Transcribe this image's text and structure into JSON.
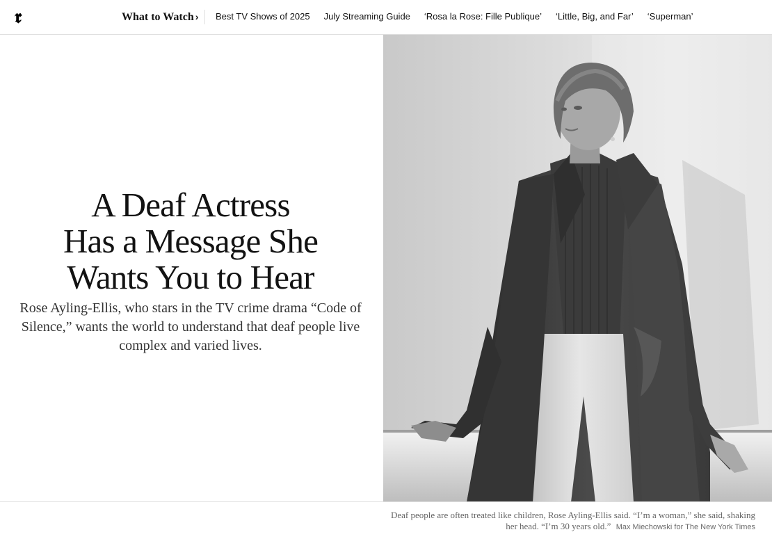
{
  "nav": {
    "logo_glyph": "𝖗",
    "section_label": "What to Watch",
    "section_chevron": "›",
    "items": [
      "Best TV Shows of 2025",
      "July Streaming Guide",
      "‘Rosa la Rose: Fille Publique’",
      "‘Little, Big, and Far’",
      "‘Superman’"
    ]
  },
  "article": {
    "headline_lines": [
      "A Deaf Actress",
      "Has a Message She",
      "Wants You to Hear"
    ],
    "summary": "Rose Ayling-Ellis, who stars in the TV crime drama “Code of Silence,” wants the world to understand that deaf people live complex and varied lives.",
    "photo": {
      "description_icon": "portrait-photo",
      "caption": "Deaf people are often treated like children, Rose Ayling-Ellis said. “I’m a woman,” she said, shaking her head. “I’m 30 years old.”",
      "credit": "Max Miechowski for The New York Times"
    }
  }
}
